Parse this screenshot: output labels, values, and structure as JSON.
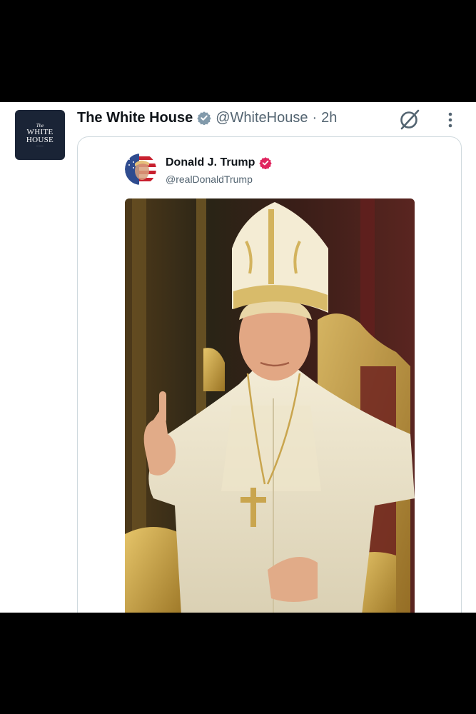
{
  "tweet": {
    "avatar_text": {
      "the": "The",
      "name_line1": "WHITE",
      "name_line2": "HOUSE"
    },
    "display_name": "The White House",
    "handle": "@WhiteHouse",
    "separator": "·",
    "time": "2h",
    "verified_badge_color": "#829aab"
  },
  "quote": {
    "display_name": "Donald J. Trump",
    "handle": "@realDonaldTrump",
    "verified_badge_color": "#e0245e"
  },
  "colors": {
    "text_primary": "#0f1419",
    "text_secondary": "#536471",
    "border": "#cfd9de"
  }
}
